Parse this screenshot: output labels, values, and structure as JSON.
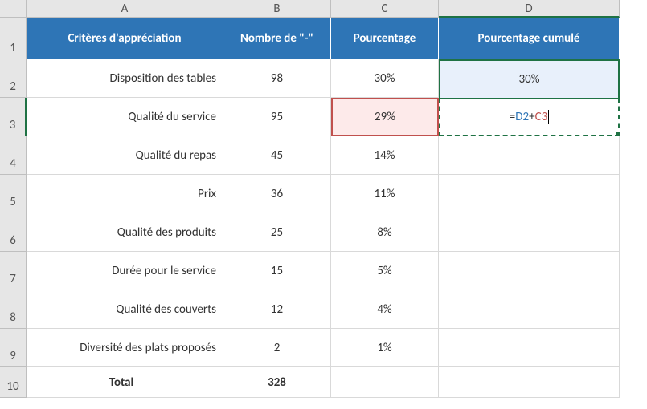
{
  "columns": [
    "A",
    "B",
    "C",
    "D"
  ],
  "rows": [
    "1",
    "2",
    "3",
    "4",
    "5",
    "6",
    "7",
    "8",
    "9",
    "10"
  ],
  "headers": {
    "A": "Critères d'appréciation",
    "B": "Nombre de \"-\"",
    "C": "Pourcentage",
    "D": "Pourcentage cumulé"
  },
  "data": [
    {
      "critere": "Disposition des tables",
      "nombre": "98",
      "pct": "30%",
      "cum": "30%"
    },
    {
      "critere": "Qualité du service",
      "nombre": "95",
      "pct": "29%",
      "cum": ""
    },
    {
      "critere": "Qualité du repas",
      "nombre": "45",
      "pct": "14%",
      "cum": ""
    },
    {
      "critere": "Prix",
      "nombre": "36",
      "pct": "11%",
      "cum": ""
    },
    {
      "critere": "Qualité des produits",
      "nombre": "25",
      "pct": "8%",
      "cum": ""
    },
    {
      "critere": "Durée pour le service",
      "nombre": "15",
      "pct": "5%",
      "cum": ""
    },
    {
      "critere": "Qualité des couverts",
      "nombre": "12",
      "pct": "4%",
      "cum": ""
    },
    {
      "critere": "Diversité des plats proposés",
      "nombre": "2",
      "pct": "1%",
      "cum": ""
    }
  ],
  "total_row": {
    "label": "Total",
    "nombre": "328"
  },
  "formula": {
    "eq": "=",
    "ref1": "D2",
    "plus": "+",
    "ref2": "C3"
  }
}
